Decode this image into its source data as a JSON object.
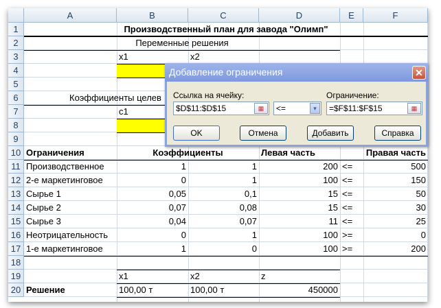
{
  "columns": [
    "A",
    "B",
    "C",
    "D",
    "E",
    "F"
  ],
  "rows": [
    "1",
    "2",
    "3",
    "4",
    "5",
    "6",
    "7",
    "8",
    "9",
    "10",
    "11",
    "12",
    "13",
    "14",
    "15",
    "16",
    "17",
    "18",
    "19",
    "20"
  ],
  "title": "Производственный план для завода \"Олимп\"",
  "vars_header": "Переменные решения",
  "x1": "x1",
  "x2": "x2",
  "z": "z",
  "coef_header": "Коэффициенты целев",
  "c1": "c1",
  "table_headers": {
    "constraints": "Ограничения",
    "coefficients": "Коэффициенты",
    "left": "Левая часть",
    "right": "Правая часть"
  },
  "constraints": [
    {
      "name": "Производственное",
      "b": "1",
      "c": "1",
      "d": "200",
      "e": "<=",
      "f": "500"
    },
    {
      "name": "2-е маркетинговое",
      "b": "0",
      "c": "1",
      "d": "100",
      "e": "<=",
      "f": "150"
    },
    {
      "name": "Сырье 1",
      "b": "0,05",
      "c": "0,1",
      "d": "15",
      "e": "<=",
      "f": "50"
    },
    {
      "name": "Сырье 2",
      "b": "0,07",
      "c": "0,08",
      "d": "15",
      "e": "<=",
      "f": "30"
    },
    {
      "name": "Сырье 3",
      "b": "0,04",
      "c": "0,07",
      "d": "11",
      "e": "<=",
      "f": "25"
    },
    {
      "name": "Неотрицательность",
      "b": "0",
      "c": "1",
      "d": "100",
      "e": ">=",
      "f": "0"
    },
    {
      "name": "1-е маркетинговое",
      "b": "1",
      "c": "0",
      "d": "100",
      "e": ">=",
      "f": "200"
    }
  ],
  "solution": {
    "label": "Решение",
    "x1": "100,00 т",
    "x2": "100,00 т",
    "z": "450000"
  },
  "dialog": {
    "title": "Добавление ограничения",
    "cell_ref_label": "Ссылка на ячейку:",
    "cell_ref_value": "$D$11:$D$15",
    "operator": "<=",
    "constraint_label": "Ограничение:",
    "constraint_value": "=$F$11:$F$15",
    "ok": "OK",
    "cancel": "Отмена",
    "add": "Добавить",
    "help": "Справка",
    "close": "✕"
  }
}
